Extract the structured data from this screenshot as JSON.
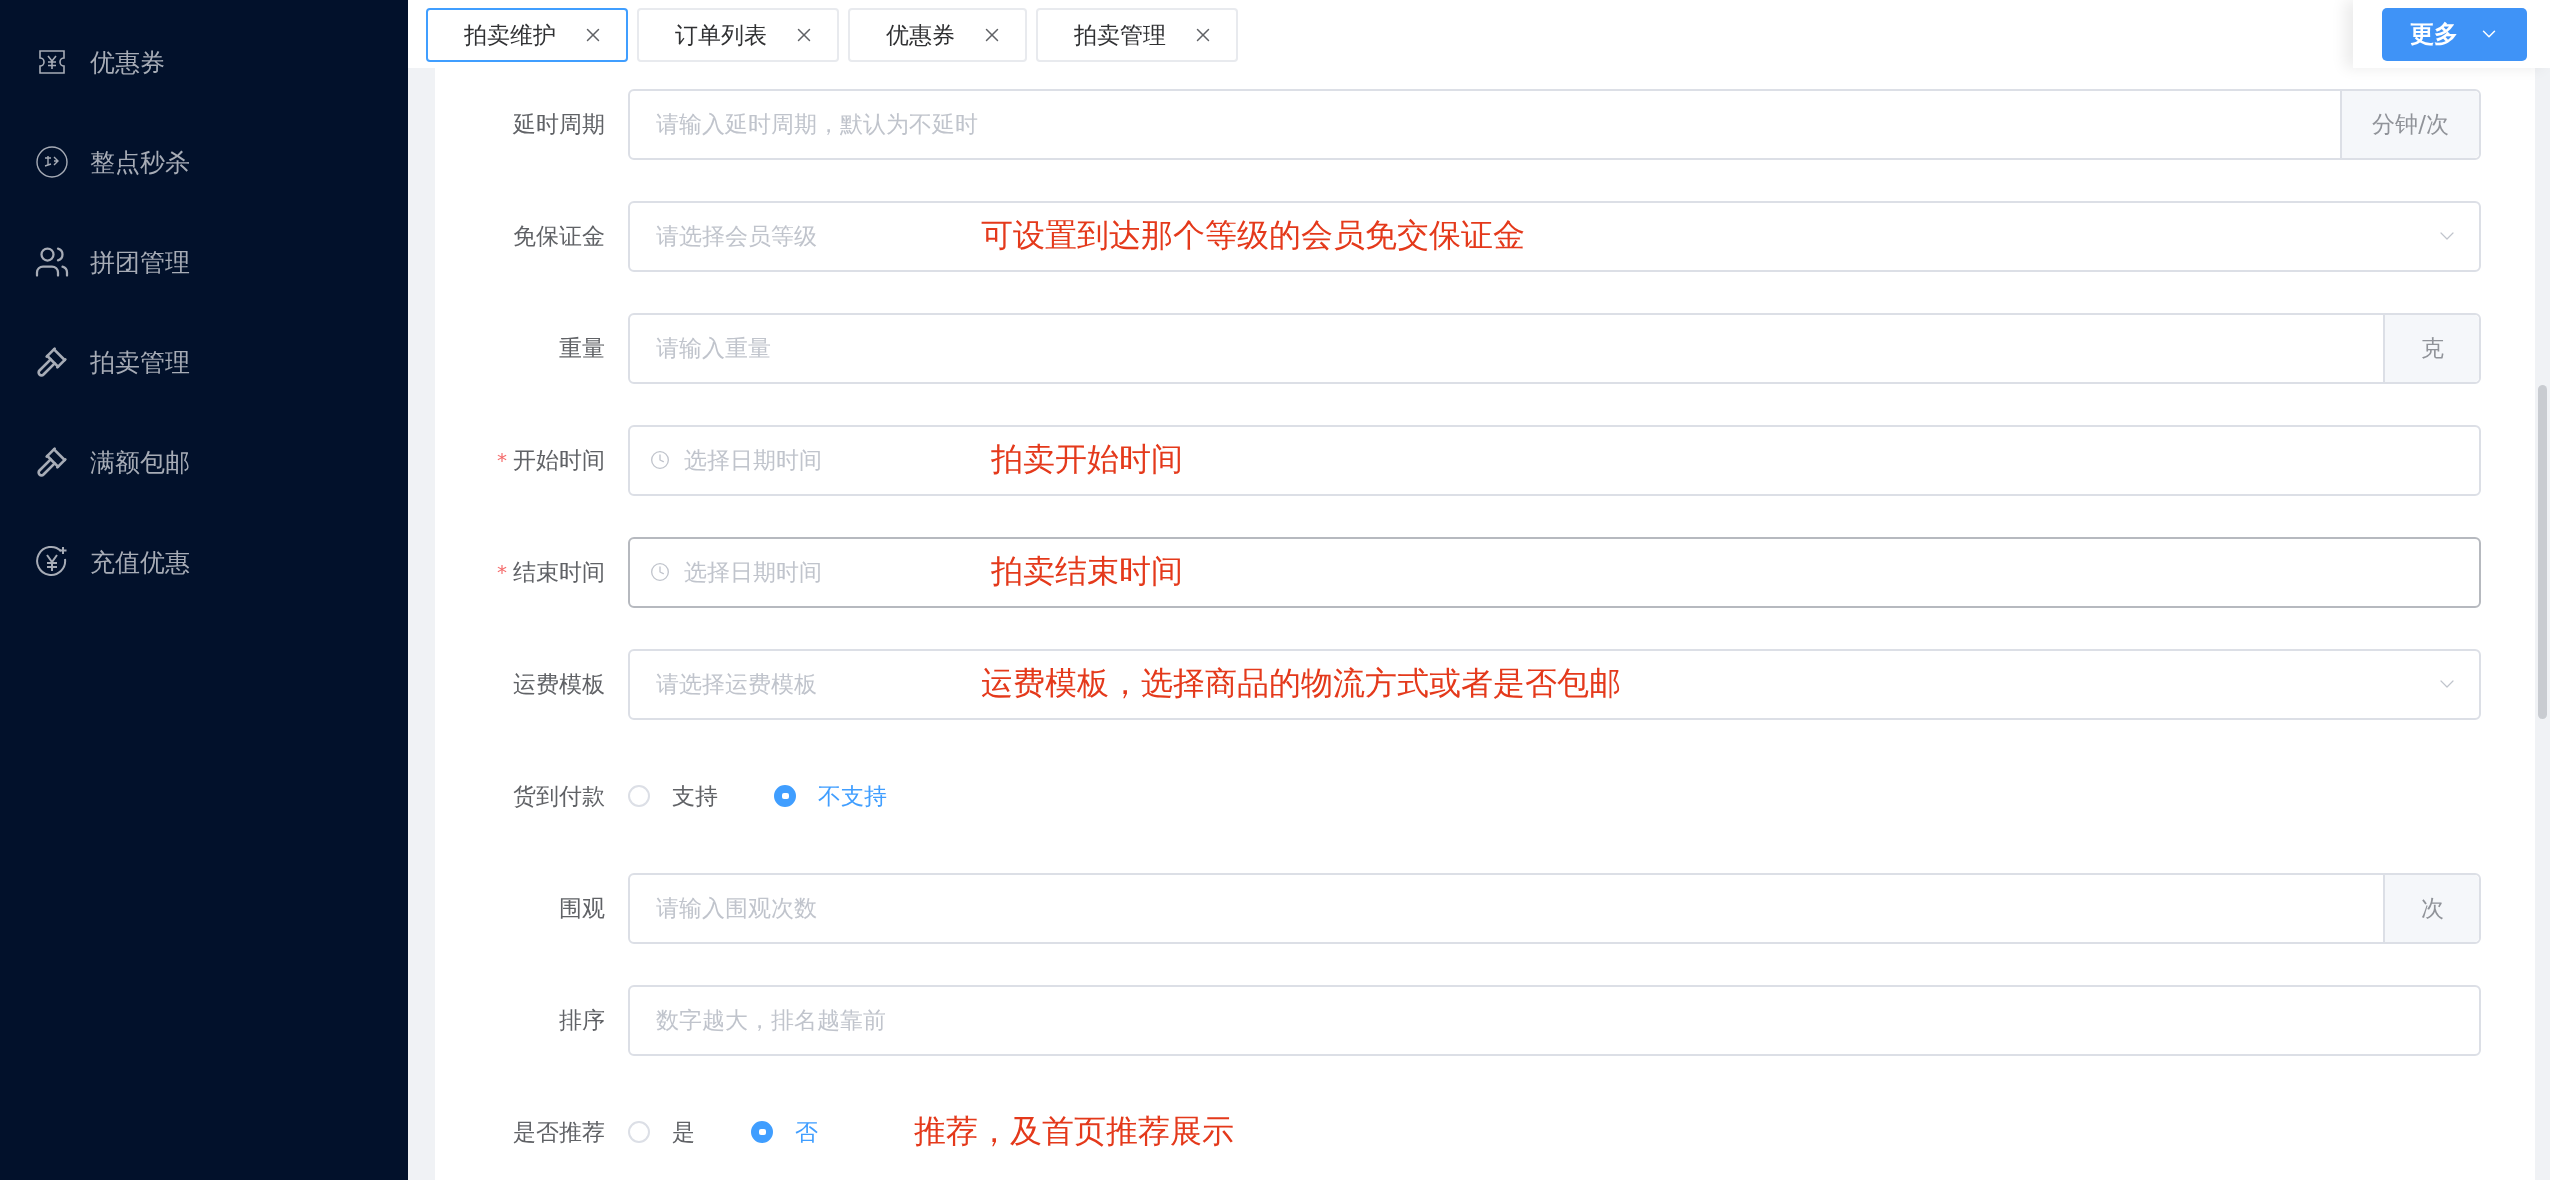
{
  "sidebar": {
    "items": [
      {
        "kind": "ticket",
        "label": "优惠券"
      },
      {
        "kind": "flash",
        "label": "整点秒杀"
      },
      {
        "kind": "group",
        "label": "拼团管理"
      },
      {
        "kind": "gavel",
        "label": "拍卖管理"
      },
      {
        "kind": "gavel",
        "label": "满额包邮"
      },
      {
        "kind": "recharge",
        "label": "充值优惠"
      }
    ]
  },
  "tabs": [
    {
      "label": "拍卖维护",
      "selected": true
    },
    {
      "label": "订单列表",
      "selected": false
    },
    {
      "label": "优惠券",
      "selected": false
    },
    {
      "label": "拍卖管理",
      "selected": false
    }
  ],
  "more_button": {
    "label": "更多"
  },
  "form": {
    "fields": [
      {
        "kind": "input",
        "label": "延时周期",
        "hovered": false,
        "placeholder": "请输入延时周期，默认为不延时",
        "suffix": "分钟/次"
      },
      {
        "kind": "select",
        "label": "免保证金",
        "hovered": false,
        "placeholder": "请选择会员等级",
        "note": "可设置到达那个等级的会员免交保证金"
      },
      {
        "kind": "input",
        "label": "重量",
        "hovered": false,
        "placeholder": "请输入重量",
        "suffix": "克"
      },
      {
        "kind": "datetime",
        "label": "开始时间",
        "required_mark": "*",
        "hovered": false,
        "placeholder": "选择日期时间",
        "note": "拍卖开始时间"
      },
      {
        "kind": "datetime",
        "label": "结束时间",
        "required_mark": "*",
        "hovered": true,
        "placeholder": "选择日期时间",
        "note": "拍卖结束时间"
      },
      {
        "kind": "select",
        "label": "运费模板",
        "hovered": false,
        "placeholder": "请选择运费模板",
        "note": "运费模板，选择商品的物流方式或者是否包邮"
      },
      {
        "kind": "radio",
        "label": "货到付款",
        "options": [
          {
            "label": "支持",
            "selected": false
          },
          {
            "label": "不支持",
            "selected": true
          }
        ]
      },
      {
        "kind": "input",
        "label": "围观",
        "hovered": false,
        "placeholder": "请输入围观次数",
        "suffix": "次"
      },
      {
        "kind": "input",
        "label": "排序",
        "hovered": false,
        "placeholder": "数字越大，排名越靠前"
      },
      {
        "kind": "radio",
        "label": "是否推荐",
        "options": [
          {
            "label": "是",
            "selected": false
          },
          {
            "label": "否",
            "selected": true
          }
        ],
        "note": "推荐，及首页推荐展示"
      }
    ]
  }
}
